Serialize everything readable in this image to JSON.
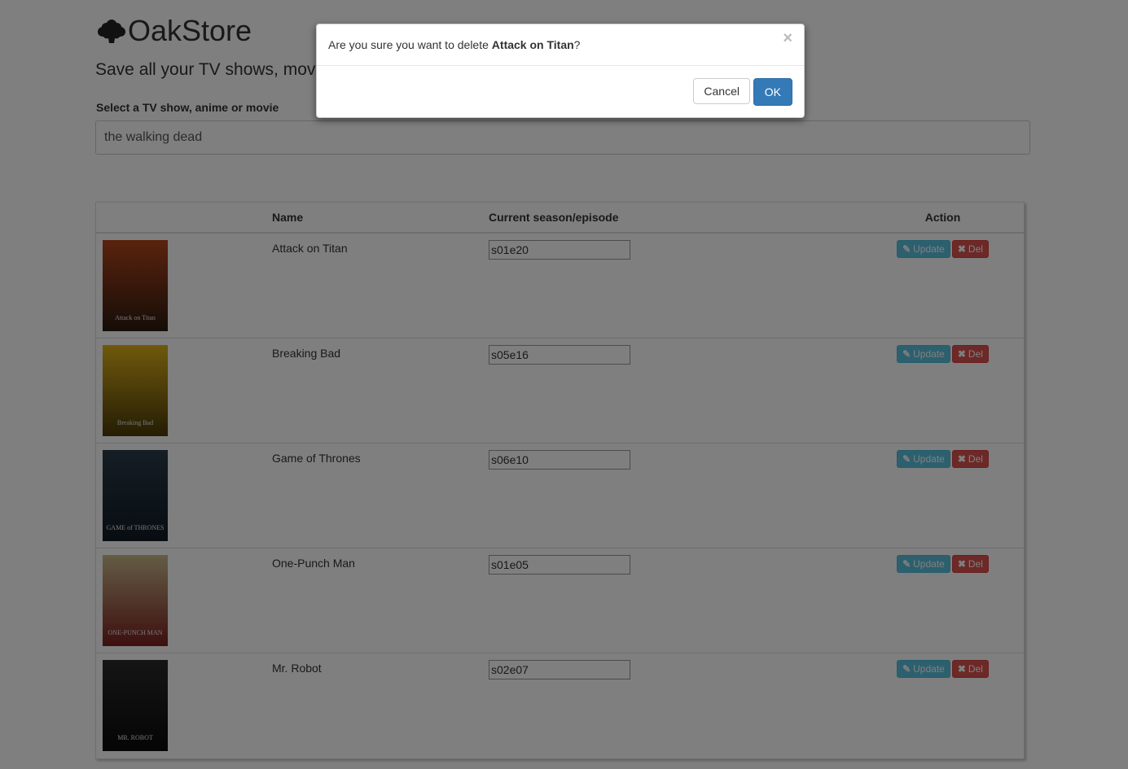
{
  "app": {
    "brand": "OakStore",
    "tagline": "Save all your TV shows, movies",
    "search_label": "Select a TV show, anime or movie",
    "search_value": "the walking dead"
  },
  "table": {
    "headers": {
      "poster": "",
      "name": "Name",
      "episode": "Current season/episode",
      "action": "Action"
    },
    "update_label": "Update",
    "delete_label": "Del",
    "rows": [
      {
        "name": "Attack on Titan",
        "episode": "s01e20",
        "poster_text": "Attack on Titan",
        "poster_colors": [
          "#b5461c",
          "#2b1a10"
        ]
      },
      {
        "name": "Breaking Bad",
        "episode": "s05e16",
        "poster_text": "Breaking Bad",
        "poster_colors": [
          "#e0b21a",
          "#4a3a08"
        ]
      },
      {
        "name": "Game of Thrones",
        "episode": "s06e10",
        "poster_text": "GAME of THRONES",
        "poster_colors": [
          "#2a3d4a",
          "#0f1a22"
        ]
      },
      {
        "name": "One-Punch Man",
        "episode": "s01e05",
        "poster_text": "ONE-PUNCH MAN",
        "poster_colors": [
          "#c9b98a",
          "#7a1f1f"
        ]
      },
      {
        "name": "Mr. Robot",
        "episode": "s02e07",
        "poster_text": "MR. ROBOT",
        "poster_colors": [
          "#2a2a2a",
          "#0a0a0a"
        ]
      }
    ]
  },
  "modal": {
    "message_prefix": "Are you sure you want to delete ",
    "message_item": "Attack on Titan",
    "message_suffix": "?",
    "close_glyph": "×",
    "cancel_label": "Cancel",
    "ok_label": "OK"
  },
  "colors": {
    "overlay": "rgba(0,0,0,0.5)",
    "primary": "#337ab7",
    "info": "#5bc0de",
    "danger": "#d9534f"
  }
}
